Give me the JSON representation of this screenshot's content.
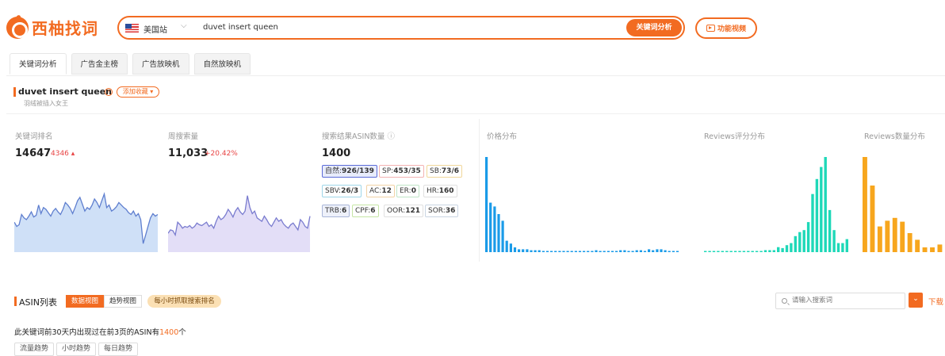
{
  "header": {
    "logo_text": "西柚找词",
    "site": "美国站",
    "search_value": "duvet insert queen",
    "analyze_label": "关键词分析",
    "video_label": "功能视频"
  },
  "tabs": [
    "关键词分析",
    "广告金主榜",
    "广告放映机",
    "自然放映机"
  ],
  "keyword": {
    "title": "duvet insert queen",
    "fav_label": "添加收藏 ▾",
    "subtitle": "羽绒被插入女王"
  },
  "metrics": {
    "rank_label": "关键词排名",
    "rank_value": "14647",
    "rank_delta": "4346",
    "weekly_label": "周搜索量",
    "weekly_value": "11,033",
    "weekly_delta": "+20.42%",
    "asin_label": "搜索结果ASIN数量",
    "asin_value": "1400"
  },
  "chips": [
    {
      "label": "自然:",
      "value": "926/139",
      "color": "#5b6bd8",
      "bg": "#e8ecfb"
    },
    {
      "label": "SP:",
      "value": "453/35",
      "color": "#f3b2b2",
      "bg": "#fff"
    },
    {
      "label": "SB:",
      "value": "73/6",
      "color": "#f0d79a",
      "bg": "#fff"
    },
    {
      "label": "SBV:",
      "value": "26/3",
      "color": "#9fd6e8",
      "bg": "#fff"
    },
    {
      "label": "AC:",
      "value": "12",
      "color": "#f1d2a6",
      "bg": "#fff"
    },
    {
      "label": "ER:",
      "value": "0",
      "color": "#bfe5c7",
      "bg": "#fff"
    },
    {
      "label": "HR:",
      "value": "160",
      "color": "#e0e0e0",
      "bg": "#fff"
    },
    {
      "label": "TRB:",
      "value": "6",
      "color": "#a9b6d8",
      "bg": "#eef1fa"
    },
    {
      "label": "CPF:",
      "value": "6",
      "color": "#c5e5a5",
      "bg": "#fff"
    },
    {
      "label": "OOR:",
      "value": "121",
      "color": "#e0e0e0",
      "bg": "#fff"
    },
    {
      "label": "SOR:",
      "value": "36",
      "color": "#c9d5e3",
      "bg": "#fff"
    }
  ],
  "distributions": {
    "price_label": "价格分布",
    "rating_label": "Reviews评分分布",
    "count_label": "Reviews数量分布"
  },
  "chart_data": [
    {
      "type": "area",
      "title": "关键词排名",
      "values": [
        0.35,
        0.3,
        0.32,
        0.44,
        0.4,
        0.38,
        0.42,
        0.47,
        0.41,
        0.43,
        0.55,
        0.45,
        0.52,
        0.5,
        0.46,
        0.42,
        0.48,
        0.51,
        0.47,
        0.44,
        0.5,
        0.58,
        0.55,
        0.51,
        0.45,
        0.52,
        0.6,
        0.64,
        0.56,
        0.48,
        0.52,
        0.5,
        0.55,
        0.62,
        0.58,
        0.52,
        0.6,
        0.68,
        0.52,
        0.55,
        0.48,
        0.5,
        0.53,
        0.58,
        0.55,
        0.52,
        0.5,
        0.46,
        0.44,
        0.48,
        0.42,
        0.45,
        0.38,
        0.1,
        0.2,
        0.3,
        0.4,
        0.45,
        0.42,
        0.44
      ],
      "color": "#5f7fcf",
      "fill": "#cfe0f7"
    },
    {
      "type": "area",
      "title": "周搜索量",
      "values": [
        0.22,
        0.26,
        0.25,
        0.2,
        0.35,
        0.32,
        0.28,
        0.3,
        0.29,
        0.31,
        0.28,
        0.3,
        0.34,
        0.32,
        0.31,
        0.33,
        0.35,
        0.3,
        0.32,
        0.28,
        0.36,
        0.42,
        0.38,
        0.4,
        0.44,
        0.5,
        0.46,
        0.41,
        0.48,
        0.52,
        0.47,
        0.44,
        0.48,
        0.66,
        0.52,
        0.45,
        0.48,
        0.4,
        0.38,
        0.36,
        0.42,
        0.38,
        0.33,
        0.3,
        0.35,
        0.4,
        0.36,
        0.38,
        0.33,
        0.3,
        0.28,
        0.32,
        0.34,
        0.3,
        0.26,
        0.38,
        0.35,
        0.3,
        0.28,
        0.42
      ],
      "color": "#7a7ccf",
      "fill": "#e3def7"
    },
    {
      "type": "bar",
      "title": "价格分布",
      "values": [
        100,
        52,
        48,
        40,
        33,
        12,
        9,
        5,
        3,
        3,
        3,
        2,
        2,
        2,
        1,
        1,
        1,
        1,
        1,
        1,
        1,
        1,
        1,
        1,
        1,
        1,
        1,
        2,
        1,
        1,
        1,
        1,
        1,
        2,
        2,
        1,
        1,
        2,
        2,
        1,
        3,
        2,
        3,
        3,
        2,
        1,
        1,
        0
      ],
      "color": "#1a9be8"
    },
    {
      "type": "bar",
      "title": "Reviews评分分布",
      "values": [
        1,
        0,
        0,
        0,
        0,
        1,
        0,
        0,
        0,
        0,
        1,
        1,
        1,
        1,
        2,
        2,
        2,
        5,
        4,
        7,
        9,
        16,
        20,
        22,
        30,
        58,
        73,
        85,
        95,
        42,
        22,
        9,
        9,
        13
      ],
      "color": "#1ed8b8"
    },
    {
      "type": "bar",
      "title": "Reviews数量分布",
      "values": [
        100,
        70,
        27,
        33,
        36,
        32,
        20,
        13,
        5,
        5,
        8
      ],
      "color": "#f7a61d"
    }
  ],
  "asin_list": {
    "title": "ASIN列表",
    "data_view": "数据视图",
    "trend_view": "趋势视图",
    "pill": "每小时抓取搜索排名",
    "search_placeholder": "请输入搜索词",
    "download_label": "下载",
    "desc_prefix": "此关键词前30天内出现过在前3页的ASIN有",
    "desc_count": "1400",
    "desc_suffix": "个",
    "trend_buttons": [
      "流量趋势",
      "小时趋势",
      "每日趋势"
    ]
  }
}
